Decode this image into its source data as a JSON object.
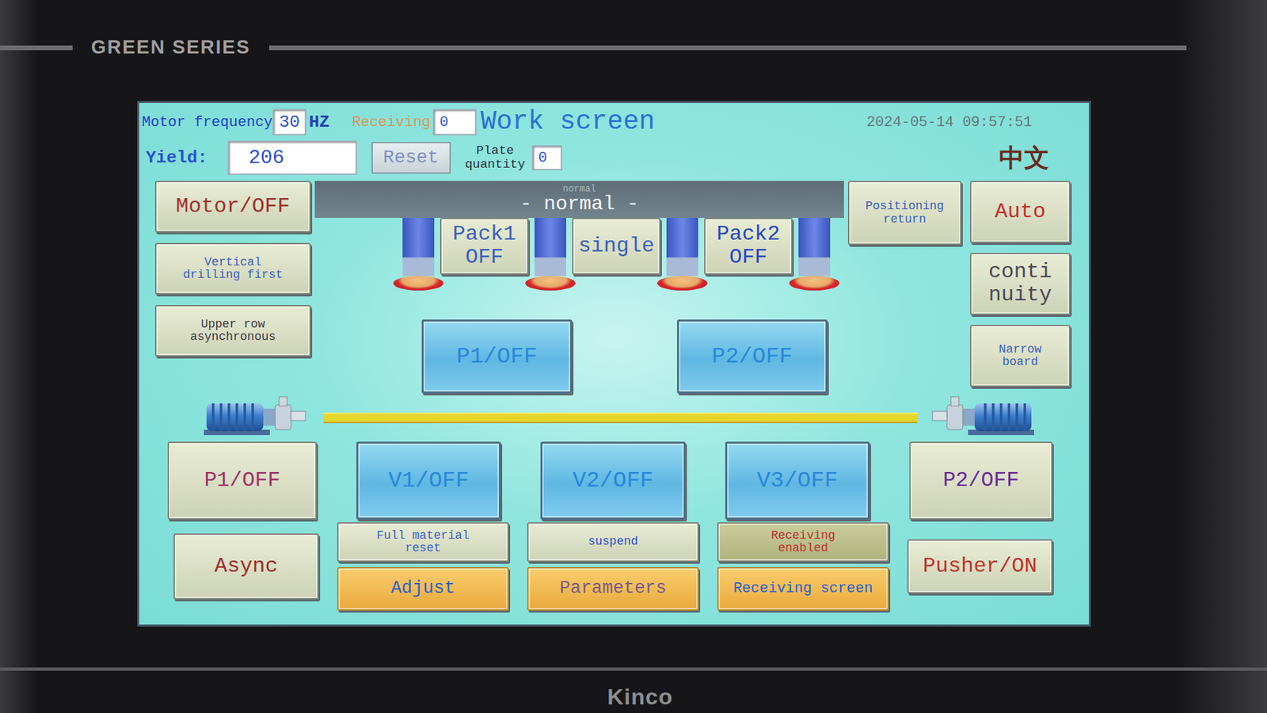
{
  "device": {
    "series": "GREEN SERIES",
    "brand": "Kinco"
  },
  "header": {
    "motor_frequency": {
      "label": "Motor frequency",
      "value": "30",
      "unit": "HZ"
    },
    "receiving": {
      "label": "Receiving",
      "value": "0"
    },
    "title": "Work screen",
    "datetime": "2024-05-14 09:57:51",
    "yield": {
      "label": "Yield:",
      "value": "206"
    },
    "reset_button": "Reset",
    "plate_quantity": {
      "label_lines": [
        "Plate",
        "quantity"
      ],
      "value": "0"
    },
    "language": "中文"
  },
  "status": {
    "previous": "normal",
    "current": "- normal -"
  },
  "left_buttons": [
    {
      "lines": [
        "Motor/OFF"
      ],
      "kind": "large",
      "color": "#a0302a"
    },
    {
      "lines": [
        "Vertical",
        "drilling first"
      ],
      "kind": "small",
      "color": "#3a5fc0"
    },
    {
      "lines": [
        "Upper row",
        "asynchronous"
      ],
      "kind": "small",
      "color": "#3a3a48"
    }
  ],
  "head_buttons": [
    {
      "lines": [
        "Pack1",
        "OFF"
      ],
      "kind": "large",
      "color": "#3a5fc0"
    },
    {
      "lines": [
        "single"
      ],
      "kind": "large",
      "color": "#3a5fc0"
    },
    {
      "lines": [
        "Pack2",
        "OFF"
      ],
      "kind": "large",
      "color": "#2447c4"
    }
  ],
  "pressure_buttons": [
    {
      "lines": [
        "P1/OFF"
      ],
      "kind": "blue",
      "color": "#2a86dc"
    },
    {
      "lines": [
        "P2/OFF"
      ],
      "kind": "blue",
      "color": "#2a86dc"
    }
  ],
  "right_buttons": [
    {
      "lines": [
        "Positioning",
        "return"
      ],
      "kind": "small",
      "color": "#3a5fc0"
    },
    {
      "lines": [
        "Auto"
      ],
      "kind": "large",
      "color": "#c0302a"
    },
    {
      "lines": [
        "conti",
        "nuity"
      ],
      "kind": "large",
      "color": "#4a4a58"
    },
    {
      "lines": [
        "Narrow",
        "board"
      ],
      "kind": "small",
      "color": "#3a5fc0"
    }
  ],
  "pump_row": [
    {
      "lines": [
        "P1/OFF"
      ],
      "kind": "large",
      "color": "#a0306a"
    },
    {
      "lines": [
        "V1/OFF"
      ],
      "kind": "blue",
      "color": "#2a86dc"
    },
    {
      "lines": [
        "V2/OFF"
      ],
      "kind": "blue",
      "color": "#2a86dc"
    },
    {
      "lines": [
        "V3/OFF"
      ],
      "kind": "blue",
      "color": "#2a86dc"
    },
    {
      "lines": [
        "P2/OFF"
      ],
      "kind": "large",
      "color": "#6a2a9a"
    }
  ],
  "side_buttons": [
    {
      "lines": [
        "Async"
      ],
      "kind": "large",
      "color": "#a02a2a"
    },
    {
      "lines": [
        "Pusher/ON"
      ],
      "kind": "large",
      "color": "#c0302a"
    }
  ],
  "control_buttons": [
    {
      "lines": [
        "Full material",
        "reset"
      ],
      "kind": "small",
      "color": "#3a5fd0"
    },
    {
      "lines": [
        "suspend"
      ],
      "kind": "small",
      "color": "#2a4fd0"
    },
    {
      "lines": [
        "Receiving",
        "enabled"
      ],
      "kind": "olive",
      "color": "#c03030"
    }
  ],
  "nav_buttons": [
    {
      "lines": [
        "Adjust"
      ],
      "kind": "orange",
      "color": "#2a5fd0"
    },
    {
      "lines": [
        "Parameters"
      ],
      "kind": "orange",
      "color": "#7a5a8a"
    },
    {
      "lines": [
        "Receiving screen"
      ],
      "kind": "orange",
      "color": "#2a5fd0"
    }
  ]
}
